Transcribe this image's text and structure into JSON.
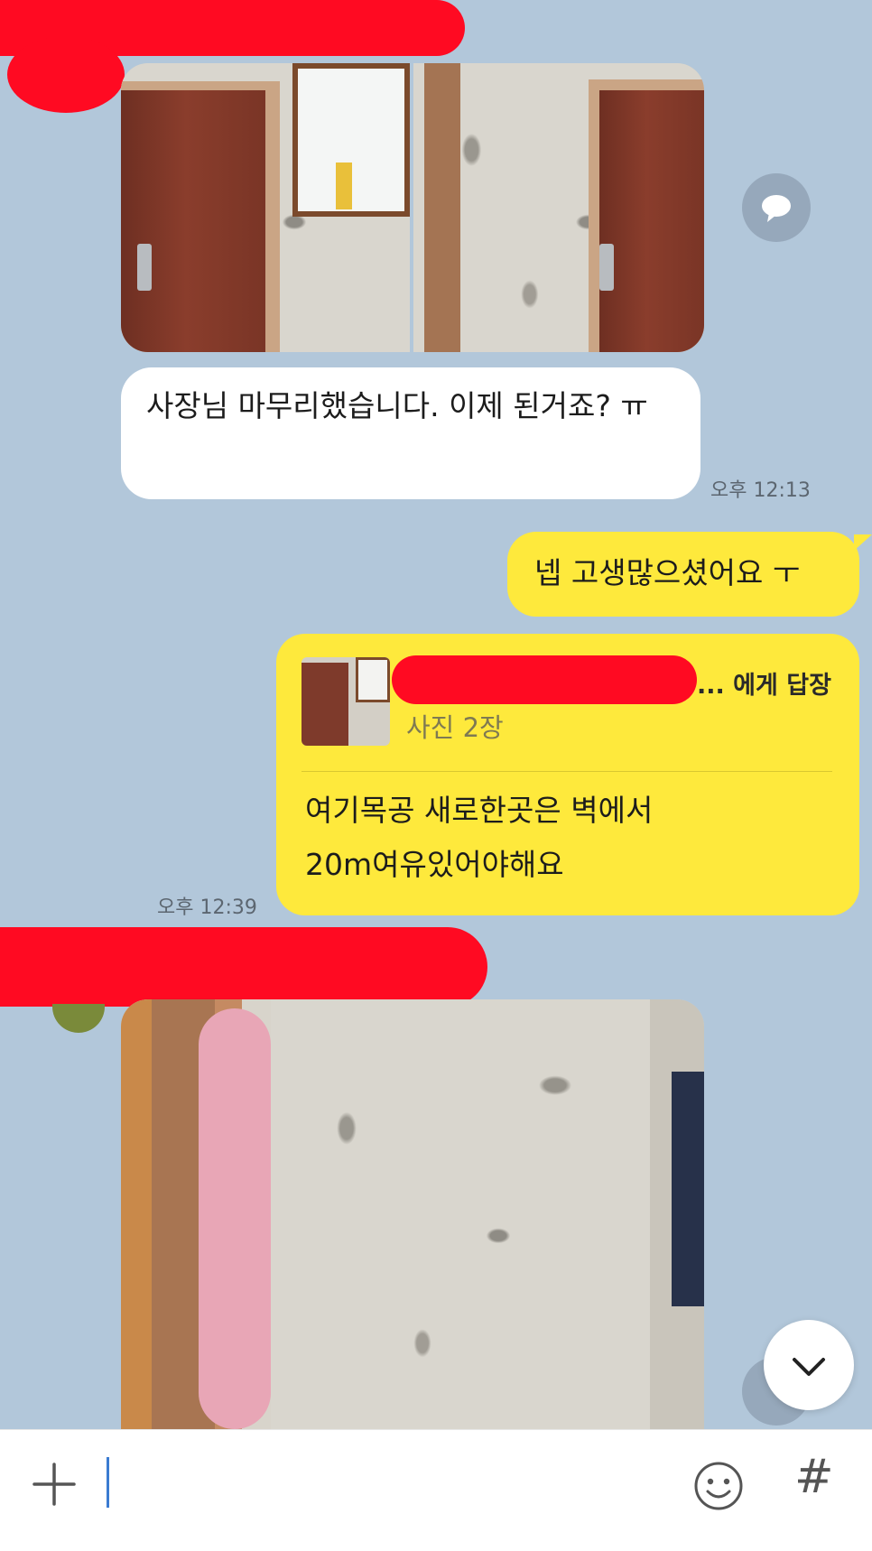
{
  "chat": {
    "incoming_message_1": {
      "text": "사장님 마무리했습니다. 이제 된거죠? ㅠ",
      "time": "오후 12:13"
    },
    "outgoing_message_1": {
      "text": "넵 고생많으셨어요 ㅜ"
    },
    "reply_message": {
      "reply_header_suffix": "... 에게 답장",
      "reply_preview": "사진 2장",
      "text_line1": "여기목공 새로한곳은 벽에서",
      "text_line2": "20m여유있어야해요",
      "time": "오후 12:39"
    }
  },
  "input_bar": {
    "icons": [
      "plus-icon",
      "emoji-icon",
      "hashtag-icon"
    ],
    "plus_glyph": "+",
    "hash_glyph": "#"
  },
  "colors": {
    "background": "#b2c7da",
    "my_bubble": "#fee93c",
    "their_bubble": "#ffffff",
    "redaction": "#ff0a22"
  }
}
